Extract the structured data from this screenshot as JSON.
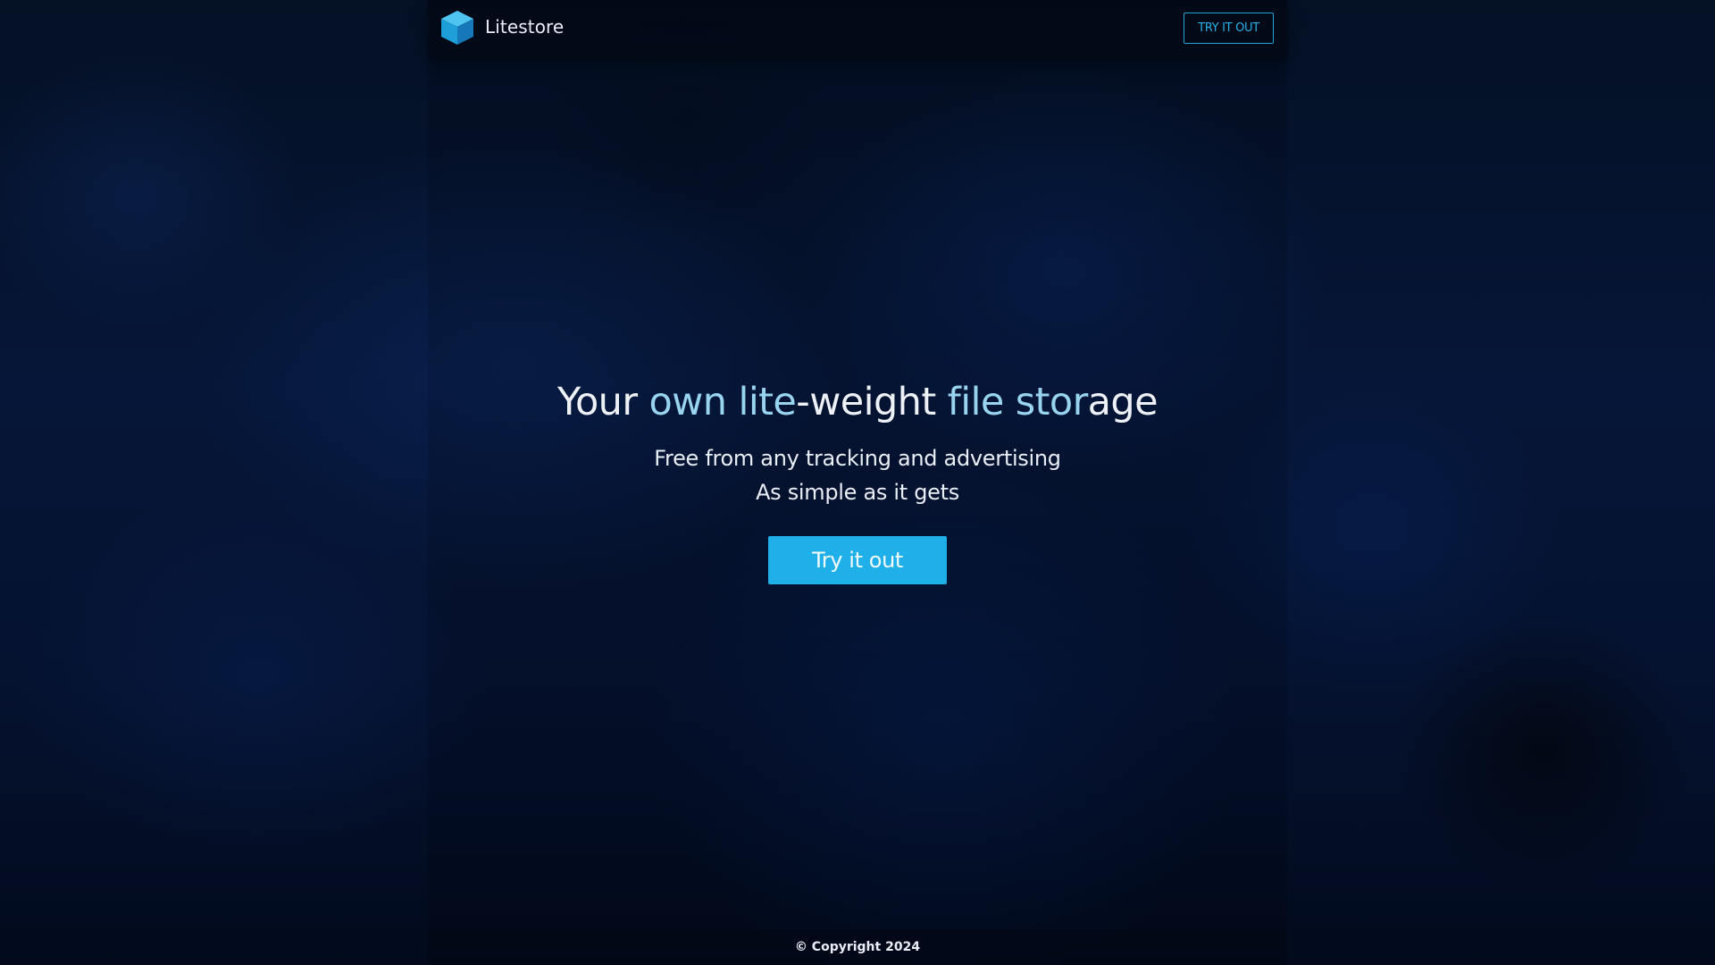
{
  "header": {
    "brand_name": "Litestore",
    "cta_label": "TRY IT OUT"
  },
  "hero": {
    "title_parts": [
      "Your ",
      "own lite",
      "-weight ",
      "file stor",
      "age"
    ],
    "subtitle_line1": "Free from any tracking and advertising",
    "subtitle_line2": "As simple as it gets",
    "cta_label": "Try it out"
  },
  "footer": {
    "copyright": "© Copyright 2024"
  },
  "colors": {
    "accent": "#1fb0e9",
    "title_highlight": "#98d4f0",
    "background": "#061638"
  },
  "icons": {
    "logo": "cube-icon"
  }
}
